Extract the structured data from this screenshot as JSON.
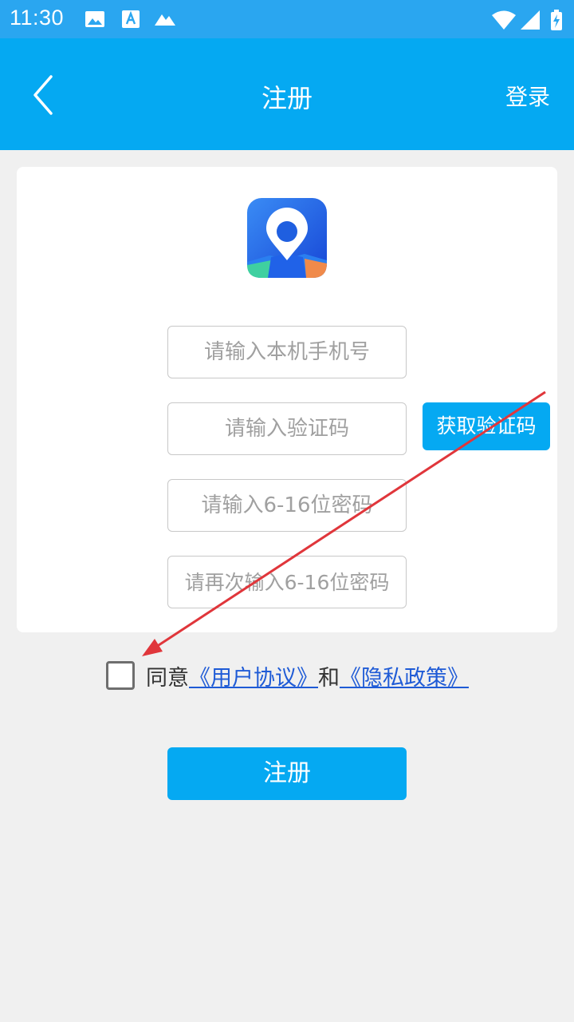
{
  "status_bar": {
    "time": "11:30",
    "icons": [
      "image-icon",
      "font-a-icon",
      "mountain-icon",
      "wifi-icon",
      "signal-icon",
      "battery-charging-icon"
    ]
  },
  "header": {
    "title": "注册",
    "back_icon": "chevron-left-icon",
    "login_label": "登录"
  },
  "form": {
    "logo_icon": "map-pin-app-logo",
    "phone_placeholder": "请输入本机手机号",
    "code_placeholder": "请输入验证码",
    "get_code_label": "获取验证码",
    "password_placeholder": "请输入6-16位密码",
    "confirm_password_placeholder": "请再次输入6-16位密码"
  },
  "agreement": {
    "agree_text": "同意",
    "user_agreement": "《用户协议》",
    "and_text": "和",
    "privacy_policy": "《隐私政策》",
    "checked": false
  },
  "register_label": "注册",
  "colors": {
    "status_bar": "#2aa6f0",
    "primary": "#05a9f2",
    "background": "#f0f0f0",
    "link": "#1f5bd6",
    "annotation_arrow": "#e0363b"
  }
}
